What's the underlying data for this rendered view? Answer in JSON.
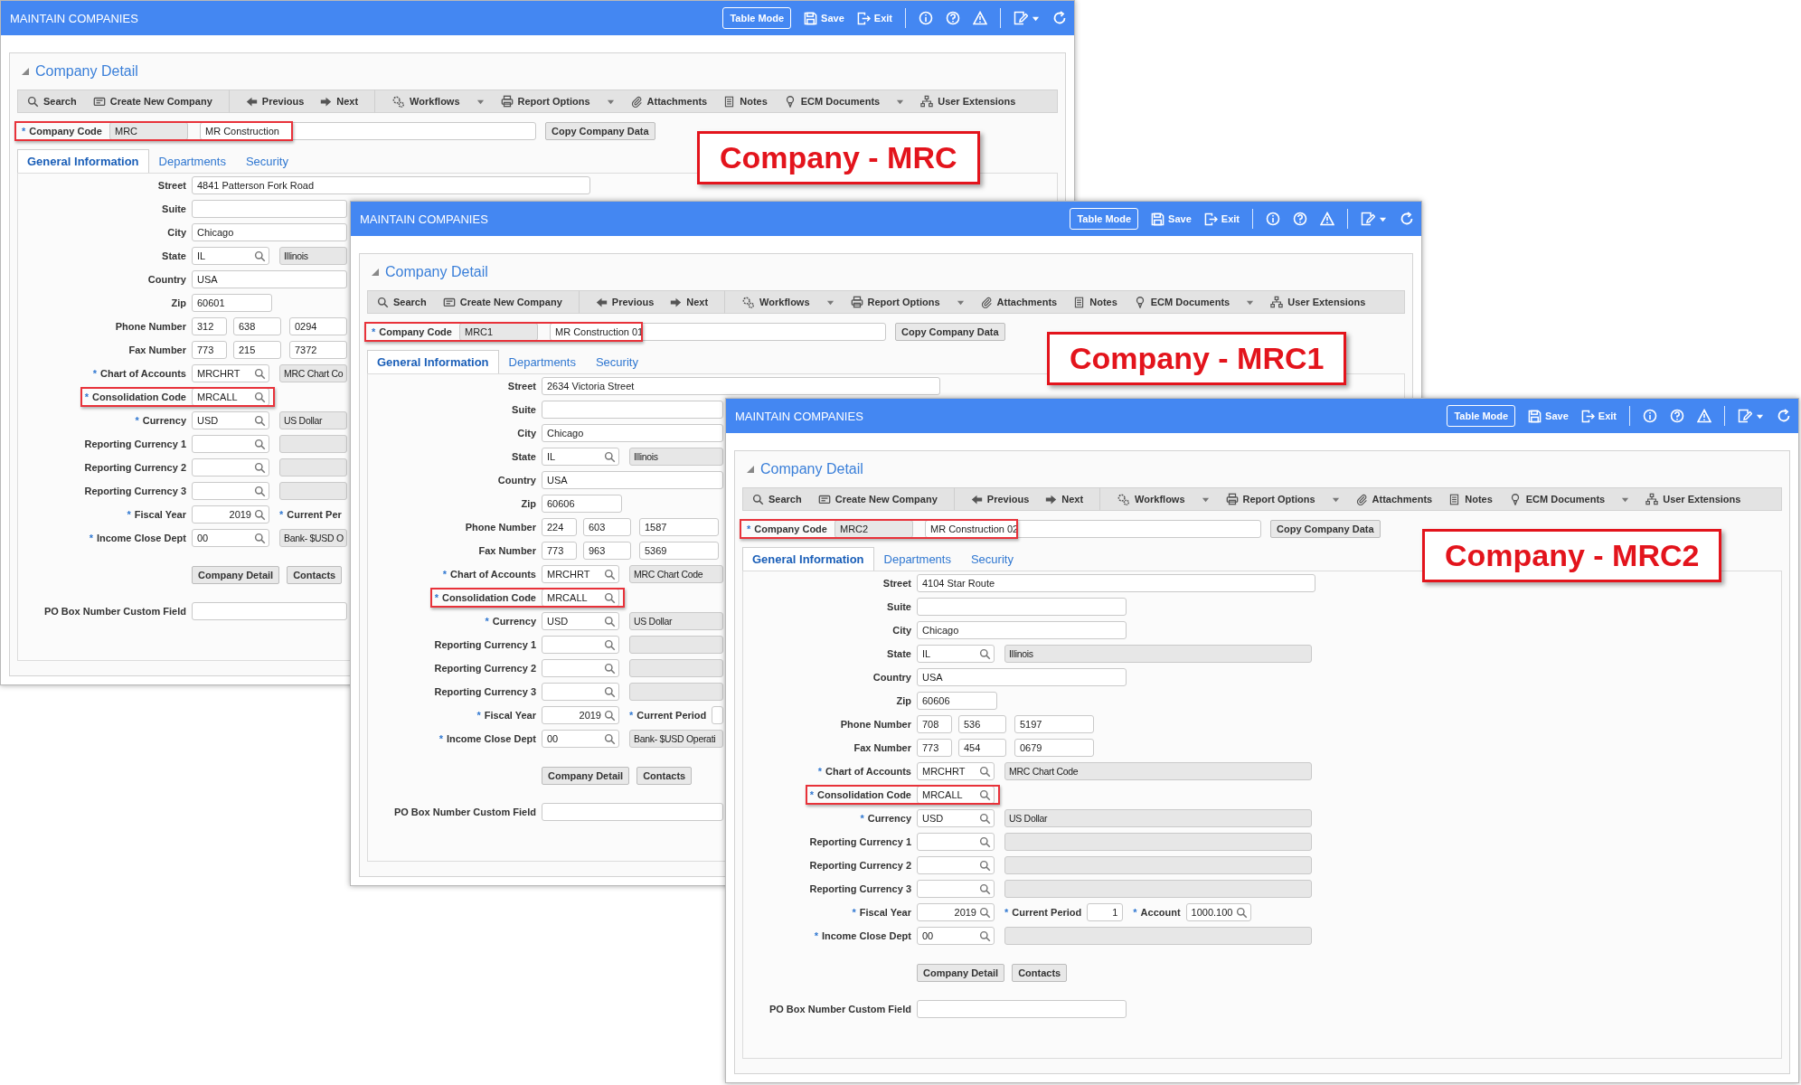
{
  "windows": [
    {
      "title": "MAINTAIN COMPANIES",
      "header_actions": [
        {
          "kind": "mode",
          "label": "Table Mode"
        },
        {
          "kind": "save",
          "label": "Save"
        },
        {
          "kind": "exit",
          "label": "Exit"
        },
        {
          "kind": "info"
        },
        {
          "kind": "help"
        },
        {
          "kind": "warning"
        },
        {
          "kind": "edit"
        },
        {
          "kind": "refresh"
        }
      ],
      "panel_title": "Company Detail",
      "toolbar": [
        {
          "kind": "search",
          "label": "Search",
          "dropdown": false
        },
        {
          "kind": "create",
          "label": "Create New Company",
          "dropdown": false
        },
        {
          "kind": "previous",
          "label": "Previous",
          "dropdown": false
        },
        {
          "kind": "next",
          "label": "Next",
          "dropdown": false
        },
        {
          "kind": "workflows",
          "label": "Workflows",
          "dropdown": true
        },
        {
          "kind": "report",
          "label": "Report Options",
          "dropdown": true
        },
        {
          "kind": "attachments",
          "label": "Attachments",
          "dropdown": false
        },
        {
          "kind": "notes",
          "label": "Notes",
          "dropdown": false
        },
        {
          "kind": "ecm",
          "label": "ECM Documents",
          "dropdown": true
        },
        {
          "kind": "extensions",
          "label": "User Extensions",
          "dropdown": false
        }
      ],
      "company": {
        "mark": "*",
        "label": "Company Code",
        "code": "MRC",
        "name": "MR Construction",
        "highlighted": true,
        "copy_button": "Copy Company Data"
      },
      "callout": "Company - MRC",
      "tabs": [
        {
          "label": "General Information",
          "selected": true
        },
        {
          "label": "Departments",
          "selected": false
        },
        {
          "label": "Security",
          "selected": false
        }
      ],
      "form": [
        {
          "kind": "long_text",
          "label": "Street",
          "value": "4841 Patterson Fork Road",
          "highlighted": false
        },
        {
          "kind": "text",
          "label": "Suite",
          "highlighted": false
        },
        {
          "kind": "text",
          "label": "City",
          "value": "Chicago",
          "highlighted": false
        },
        {
          "kind": "lookup",
          "label": "State",
          "value": "IL",
          "desc_box": true,
          "desc": "Illinois",
          "highlighted": false
        },
        {
          "kind": "text",
          "label": "Country",
          "value": "USA",
          "highlighted": false
        },
        {
          "kind": "short_text",
          "label": "Zip",
          "value": "60601",
          "highlighted": false
        },
        {
          "kind": "phone",
          "label": "Phone Number",
          "parts": [
            "312",
            "638",
            "0294"
          ],
          "highlighted": false
        },
        {
          "kind": "phone",
          "label": "Fax Number",
          "parts": [
            "773",
            "215",
            "7372"
          ],
          "highlighted": false
        },
        {
          "kind": "lookup",
          "mark": "*",
          "label": "Chart of Accounts",
          "value": "MRCHRT",
          "desc_box": true,
          "desc": "MRC Chart Co",
          "highlighted": false
        },
        {
          "kind": "lookup",
          "mark": "*",
          "label": "Consolidation Code",
          "value": "MRCALL",
          "desc_box": false,
          "highlighted": true
        },
        {
          "kind": "lookup",
          "mark": "*",
          "label": "Currency",
          "value": "USD",
          "desc_box": true,
          "desc": "US Dollar",
          "highlighted": false
        },
        {
          "kind": "lookup",
          "label": "Reporting Currency 1",
          "desc_box": true,
          "highlighted": false
        },
        {
          "kind": "lookup",
          "label": "Reporting Currency 2",
          "desc_box": true,
          "highlighted": false
        },
        {
          "kind": "lookup",
          "label": "Reporting Currency 3",
          "desc_box": true,
          "highlighted": false
        },
        {
          "kind": "lookup",
          "mark": "*",
          "label": "Fiscal Year",
          "value": "2019",
          "numeric": true,
          "desc_box": false,
          "highlighted": false,
          "extras": [
            {
              "mark": "*",
              "label": "Current Per"
            }
          ]
        },
        {
          "kind": "lookup",
          "mark": "*",
          "label": "Income Close Dept",
          "value": "00",
          "desc_box": true,
          "desc": "Bank- $USD O",
          "highlighted": false
        }
      ],
      "buttons": [
        "Company Detail",
        "Contacts"
      ],
      "custom_field": {
        "label": "PO Box Number Custom Field"
      }
    },
    {
      "title": "MAINTAIN COMPANIES",
      "header_actions": [
        {
          "kind": "mode",
          "label": "Table Mode"
        },
        {
          "kind": "save",
          "label": "Save"
        },
        {
          "kind": "exit",
          "label": "Exit"
        },
        {
          "kind": "info"
        },
        {
          "kind": "help"
        },
        {
          "kind": "warning"
        },
        {
          "kind": "edit"
        },
        {
          "kind": "refresh"
        }
      ],
      "panel_title": "Company Detail",
      "toolbar": [
        {
          "kind": "search",
          "label": "Search",
          "dropdown": false
        },
        {
          "kind": "create",
          "label": "Create New Company",
          "dropdown": false
        },
        {
          "kind": "previous",
          "label": "Previous",
          "dropdown": false
        },
        {
          "kind": "next",
          "label": "Next",
          "dropdown": false
        },
        {
          "kind": "workflows",
          "label": "Workflows",
          "dropdown": true
        },
        {
          "kind": "report",
          "label": "Report Options",
          "dropdown": true
        },
        {
          "kind": "attachments",
          "label": "Attachments",
          "dropdown": false
        },
        {
          "kind": "notes",
          "label": "Notes",
          "dropdown": false
        },
        {
          "kind": "ecm",
          "label": "ECM Documents",
          "dropdown": true
        },
        {
          "kind": "extensions",
          "label": "User Extensions",
          "dropdown": false
        }
      ],
      "company": {
        "mark": "*",
        "label": "Company Code",
        "code": "MRC1",
        "name": "MR Construction 01",
        "highlighted": true,
        "copy_button": "Copy Company Data"
      },
      "callout": "Company - MRC1",
      "tabs": [
        {
          "label": "General Information",
          "selected": true
        },
        {
          "label": "Departments",
          "selected": false
        },
        {
          "label": "Security",
          "selected": false
        }
      ],
      "form": [
        {
          "kind": "long_text",
          "label": "Street",
          "value": "2634 Victoria Street",
          "highlighted": false
        },
        {
          "kind": "text",
          "label": "Suite",
          "highlighted": false
        },
        {
          "kind": "text",
          "label": "City",
          "value": "Chicago",
          "highlighted": false
        },
        {
          "kind": "lookup",
          "label": "State",
          "value": "IL",
          "desc_box": true,
          "desc": "Illinois",
          "highlighted": false
        },
        {
          "kind": "text",
          "label": "Country",
          "value": "USA",
          "highlighted": false
        },
        {
          "kind": "short_text",
          "label": "Zip",
          "value": "60606",
          "highlighted": false
        },
        {
          "kind": "phone",
          "label": "Phone Number",
          "parts": [
            "224",
            "603",
            "1587"
          ],
          "highlighted": false
        },
        {
          "kind": "phone",
          "label": "Fax Number",
          "parts": [
            "773",
            "963",
            "5369"
          ],
          "highlighted": false
        },
        {
          "kind": "lookup",
          "mark": "*",
          "label": "Chart of Accounts",
          "value": "MRCHRT",
          "desc_box": true,
          "desc": "MRC Chart Code",
          "highlighted": false
        },
        {
          "kind": "lookup",
          "mark": "*",
          "label": "Consolidation Code",
          "value": "MRCALL",
          "desc_box": false,
          "highlighted": true
        },
        {
          "kind": "lookup",
          "mark": "*",
          "label": "Currency",
          "value": "USD",
          "desc_box": true,
          "desc": "US Dollar",
          "highlighted": false
        },
        {
          "kind": "lookup",
          "label": "Reporting Currency 1",
          "desc_box": true,
          "highlighted": false
        },
        {
          "kind": "lookup",
          "label": "Reporting Currency 2",
          "desc_box": true,
          "highlighted": false
        },
        {
          "kind": "lookup",
          "label": "Reporting Currency 3",
          "desc_box": true,
          "highlighted": false
        },
        {
          "kind": "lookup",
          "mark": "*",
          "label": "Fiscal Year",
          "value": "2019",
          "numeric": true,
          "desc_box": false,
          "highlighted": false,
          "extras": [
            {
              "mark": "*",
              "label": "Current Period",
              "kind": "plain"
            }
          ]
        },
        {
          "kind": "lookup",
          "mark": "*",
          "label": "Income Close Dept",
          "value": "00",
          "desc_box": true,
          "desc": "Bank- $USD Operati",
          "highlighted": false
        }
      ],
      "buttons": [
        "Company Detail",
        "Contacts"
      ],
      "custom_field": {
        "label": "PO Box Number Custom Field"
      }
    },
    {
      "title": "MAINTAIN COMPANIES",
      "header_actions": [
        {
          "kind": "mode",
          "label": "Table Mode"
        },
        {
          "kind": "save",
          "label": "Save"
        },
        {
          "kind": "exit",
          "label": "Exit"
        },
        {
          "kind": "info"
        },
        {
          "kind": "help"
        },
        {
          "kind": "warning"
        },
        {
          "kind": "edit"
        },
        {
          "kind": "refresh"
        }
      ],
      "panel_title": "Company Detail",
      "toolbar": [
        {
          "kind": "search",
          "label": "Search",
          "dropdown": false
        },
        {
          "kind": "create",
          "label": "Create New Company",
          "dropdown": false
        },
        {
          "kind": "previous",
          "label": "Previous",
          "dropdown": false
        },
        {
          "kind": "next",
          "label": "Next",
          "dropdown": false
        },
        {
          "kind": "workflows",
          "label": "Workflows",
          "dropdown": true
        },
        {
          "kind": "report",
          "label": "Report Options",
          "dropdown": true
        },
        {
          "kind": "attachments",
          "label": "Attachments",
          "dropdown": false
        },
        {
          "kind": "notes",
          "label": "Notes",
          "dropdown": false
        },
        {
          "kind": "ecm",
          "label": "ECM Documents",
          "dropdown": true
        },
        {
          "kind": "extensions",
          "label": "User Extensions",
          "dropdown": false
        }
      ],
      "company": {
        "mark": "*",
        "label": "Company Code",
        "code": "MRC2",
        "name": "MR Construction 02",
        "highlighted": true,
        "copy_button": "Copy Company Data"
      },
      "callout": "Company - MRC2",
      "tabs": [
        {
          "label": "General Information",
          "selected": true
        },
        {
          "label": "Departments",
          "selected": false
        },
        {
          "label": "Security",
          "selected": false
        }
      ],
      "form": [
        {
          "kind": "long_text",
          "label": "Street",
          "value": "4104 Star Route",
          "highlighted": false
        },
        {
          "kind": "text",
          "label": "Suite",
          "highlighted": false
        },
        {
          "kind": "text",
          "label": "City",
          "value": "Chicago",
          "highlighted": false
        },
        {
          "kind": "lookup",
          "label": "State",
          "value": "IL",
          "desc_box": true,
          "desc": "Illinois",
          "highlighted": false
        },
        {
          "kind": "text",
          "label": "Country",
          "value": "USA",
          "highlighted": false
        },
        {
          "kind": "short_text",
          "label": "Zip",
          "value": "60606",
          "highlighted": false
        },
        {
          "kind": "phone",
          "label": "Phone Number",
          "parts": [
            "708",
            "536",
            "5197"
          ],
          "highlighted": false
        },
        {
          "kind": "phone",
          "label": "Fax Number",
          "parts": [
            "773",
            "454",
            "0679"
          ],
          "highlighted": false
        },
        {
          "kind": "lookup",
          "mark": "*",
          "label": "Chart of Accounts",
          "value": "MRCHRT",
          "desc_box": true,
          "desc": "MRC Chart Code",
          "highlighted": false
        },
        {
          "kind": "lookup",
          "mark": "*",
          "label": "Consolidation Code",
          "value": "MRCALL",
          "desc_box": false,
          "highlighted": true
        },
        {
          "kind": "lookup",
          "mark": "*",
          "label": "Currency",
          "value": "USD",
          "desc_box": true,
          "desc": "US Dollar",
          "highlighted": false
        },
        {
          "kind": "lookup",
          "label": "Reporting Currency 1",
          "desc_box": true,
          "highlighted": false
        },
        {
          "kind": "lookup",
          "label": "Reporting Currency 2",
          "desc_box": true,
          "highlighted": false
        },
        {
          "kind": "lookup",
          "label": "Reporting Currency 3",
          "desc_box": true,
          "highlighted": false
        },
        {
          "kind": "lookup",
          "mark": "*",
          "label": "Fiscal Year",
          "value": "2019",
          "numeric": true,
          "desc_box": false,
          "highlighted": false,
          "extras": [
            {
              "mark": "*",
              "label": "Current Period",
              "kind": "plain",
              "value": "1"
            },
            {
              "mark": "*",
              "label": "Account",
              "kind": "lookup",
              "value": "1000.100"
            }
          ]
        },
        {
          "kind": "lookup",
          "mark": "*",
          "label": "Income Close Dept",
          "value": "00",
          "desc_box": true,
          "highlighted": false
        }
      ],
      "buttons": [
        "Company Detail",
        "Contacts"
      ],
      "custom_field": {
        "label": "PO Box Number Custom Field"
      }
    }
  ]
}
